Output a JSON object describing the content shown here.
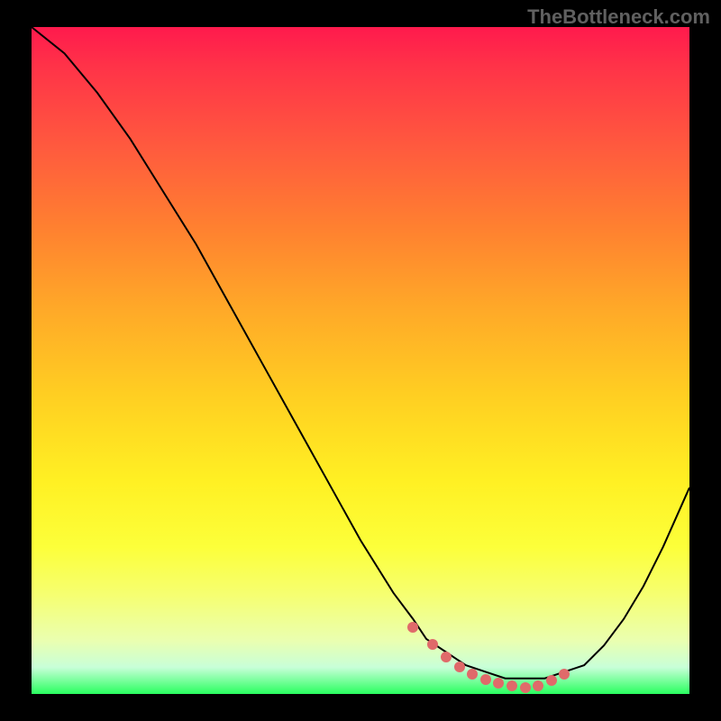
{
  "watermark": "TheBottleneck.com",
  "chart_data": {
    "type": "line",
    "title": "",
    "xlabel": "",
    "ylabel": "",
    "xlim": [
      0,
      100
    ],
    "ylim": [
      0,
      100
    ],
    "x": [
      0,
      5,
      10,
      15,
      20,
      25,
      30,
      35,
      40,
      45,
      50,
      55,
      58,
      60,
      63,
      66,
      69,
      72,
      75,
      78,
      81,
      84,
      87,
      90,
      93,
      96,
      100
    ],
    "values": [
      100,
      96,
      90,
      83,
      75,
      67,
      58,
      49,
      40,
      31,
      22,
      14,
      10,
      7,
      5,
      3,
      2,
      1,
      1,
      1,
      2,
      3,
      6,
      10,
      15,
      21,
      30
    ],
    "highlight_points_x": [
      58,
      61,
      63,
      65,
      67,
      69,
      71,
      73,
      75,
      77,
      79,
      81
    ],
    "highlight_points_y": [
      10,
      7.5,
      5.5,
      4,
      3,
      2.2,
      1.6,
      1.2,
      1,
      1.2,
      2,
      3
    ]
  },
  "colors": {
    "background": "#000000",
    "curve": "#000000",
    "point": "#e06a6a"
  }
}
